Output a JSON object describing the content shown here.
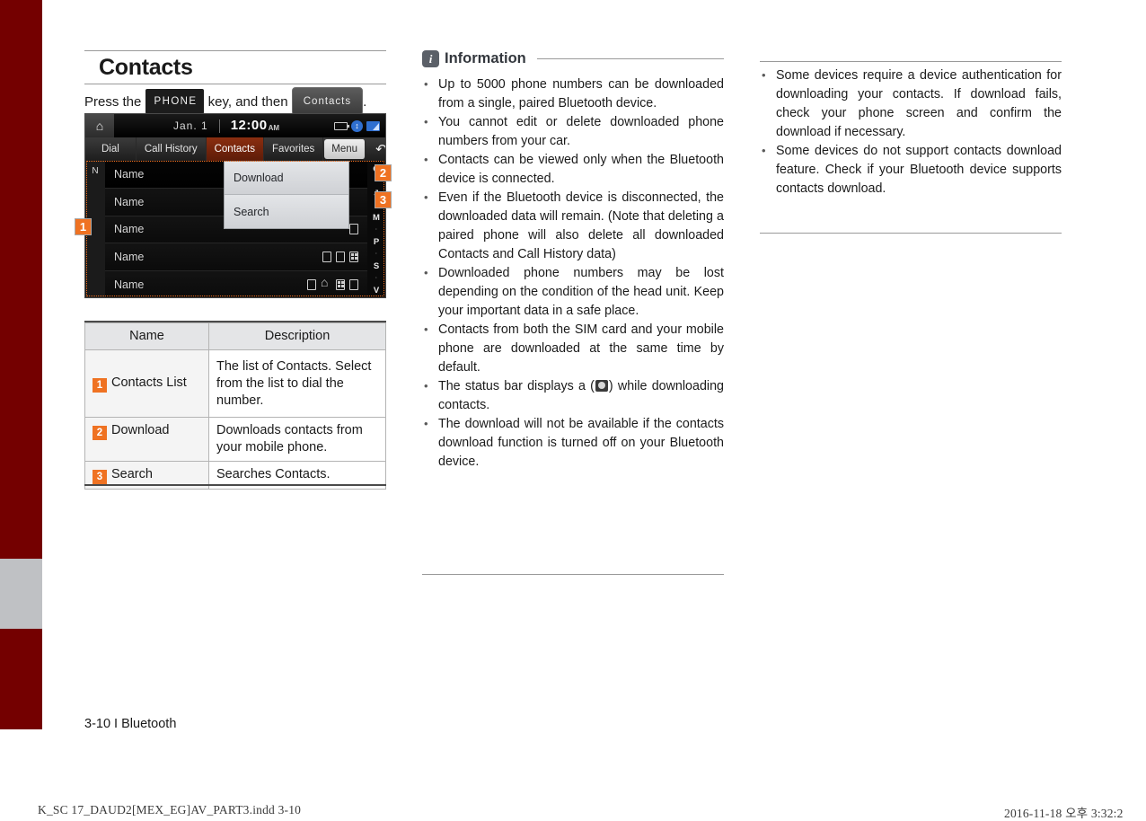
{
  "page": {
    "heading": "Contacts",
    "instruction_prefix": "Press the",
    "key_phone": "PHONE",
    "instruction_middle": "key, and then",
    "key_contacts": "Contacts",
    "instruction_suffix": ".",
    "footer": "3-10 I Bluetooth",
    "accent_orange": "#EF7222",
    "spine_maroon": "#740000",
    "spine_gray": "#BFC1C4"
  },
  "head_unit": {
    "home_icon": "home-icon",
    "date": "Jan.  1",
    "time": "12:00",
    "ampm": "AM",
    "status_icons": [
      "battery-icon",
      "bluetooth-icon",
      "signal-icon"
    ],
    "tabs": [
      {
        "label": "Dial",
        "active": false
      },
      {
        "label": "Call History",
        "active": false
      },
      {
        "label": "Contacts",
        "active": true
      },
      {
        "label": "Favorites",
        "active": false
      },
      {
        "label": "Menu",
        "active": false
      }
    ],
    "back_icon": "back-arrow-icon",
    "index_letter": "N",
    "rows": [
      {
        "label": "Name",
        "icons": []
      },
      {
        "label": "Name",
        "icons": []
      },
      {
        "label": "Name",
        "icons": [
          "sim-card-icon"
        ]
      },
      {
        "label": "Name",
        "icons": [
          "sim-card-icon",
          "sim-card-icon",
          "office-icon"
        ]
      },
      {
        "label": "Name",
        "icons": [
          "sim-card-icon",
          "home-icon",
          "office-icon",
          "sim-card-icon"
        ]
      }
    ],
    "popup_menu": [
      {
        "label": "Download"
      },
      {
        "label": "Search"
      }
    ],
    "alpha_index": [
      "G",
      "J",
      "M",
      "P",
      "S",
      "V"
    ],
    "badges": {
      "one": "1",
      "two": "2",
      "three": "3"
    }
  },
  "table": {
    "headers": [
      "Name",
      "Description"
    ],
    "rows": [
      {
        "num": "1",
        "name": "Contacts List",
        "desc": "The list of Contacts. Select from the list to dial the number."
      },
      {
        "num": "2",
        "name": "Download",
        "desc": "Downloads contacts from your mobile phone."
      },
      {
        "num": "3",
        "name": "Search",
        "desc": "Searches Contacts."
      }
    ]
  },
  "information": {
    "icon": "info-icon",
    "title": "Information",
    "bullets_col2": [
      "Up to 5000 phone numbers can be downloaded from a single, paired Bluetooth device.",
      "You cannot edit or delete downloaded phone numbers from your car.",
      "Contacts can be viewed only when the Bluetooth device is connected.",
      "Even if the Bluetooth device is disconnected, the downloaded data will remain. (Note that deleting a paired phone will also delete all downloaded Contacts and Call History data)",
      "Downloaded phone numbers may be lost depending on the condition of the head unit. Keep your important data in a safe place.",
      "Contacts from both the SIM card and your mobile phone are downloaded at the same time by default.",
      "The download will not be available if the contacts download function is turned off on your Bluetooth device."
    ],
    "bullet_status_prefix": "The status bar displays a (",
    "bullet_status_suffix": ") while downloading contacts.",
    "bullets_col3": [
      "Some devices require a device authentication for downloading your contacts. If download fails, check your phone screen and confirm the download if necessary.",
      "Some devices do not support contacts download feature. Check if your Bluetooth device supports contacts download."
    ]
  },
  "print_footer": {
    "left": "K_SC 17_DAUD2[MEX_EG]AV_PART3.indd   3-10",
    "right": "2016-11-18   오후 3:32:2"
  }
}
